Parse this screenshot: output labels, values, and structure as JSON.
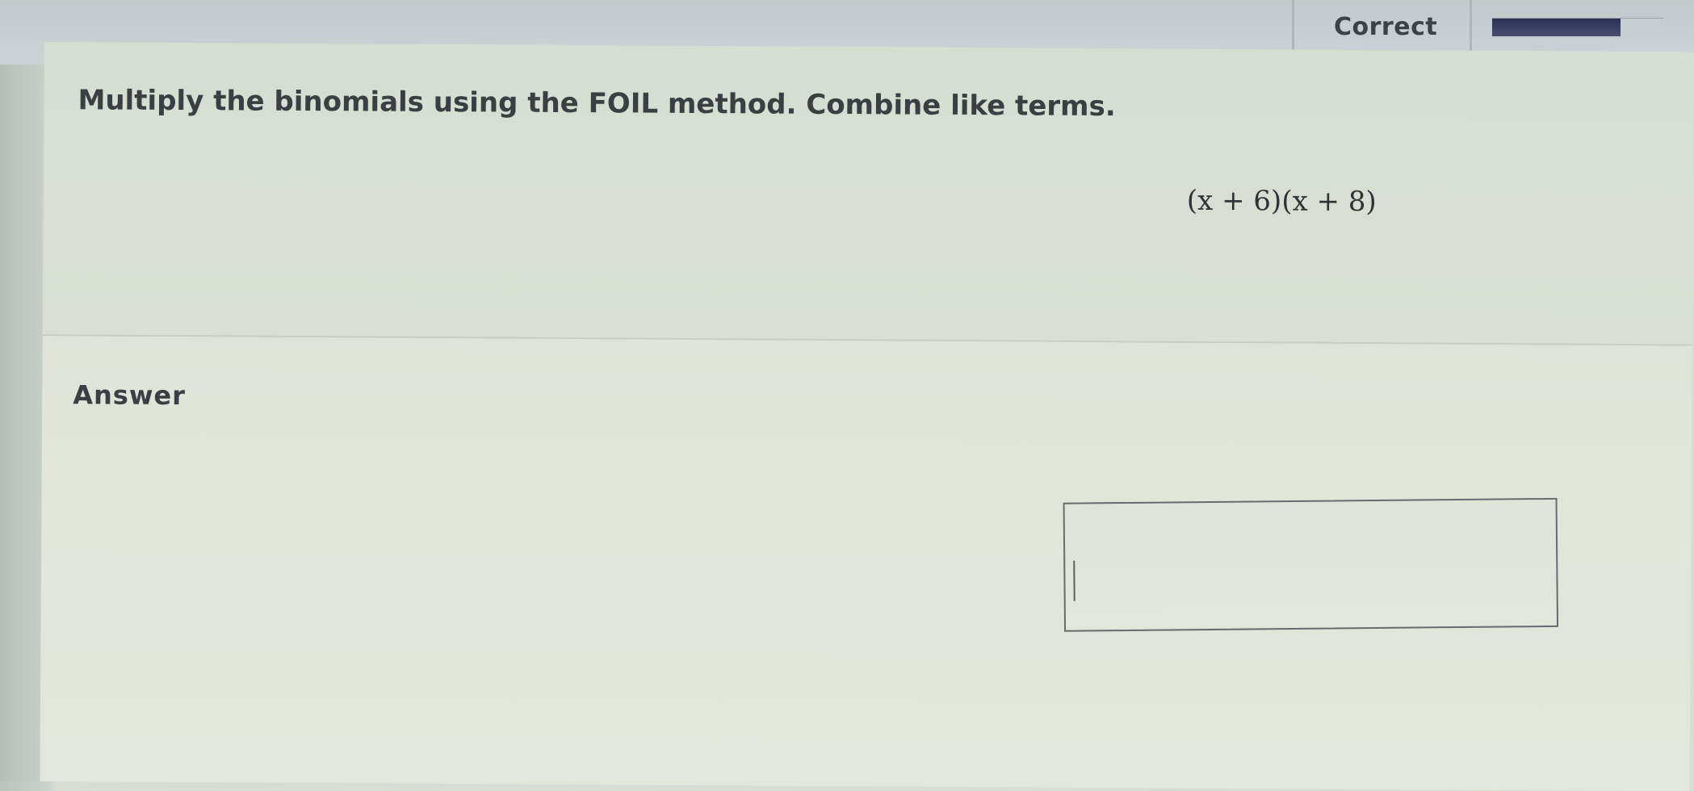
{
  "header": {
    "status_label": "Correct",
    "progress_fraction": 0.75,
    "progress_color": "#2c3252"
  },
  "question": {
    "instruction": "Multiply the binomials using the FOIL method. Combine like terms.",
    "expression": "(x + 6)(x + 8)"
  },
  "answer": {
    "label": "Answer",
    "input_value": ""
  }
}
